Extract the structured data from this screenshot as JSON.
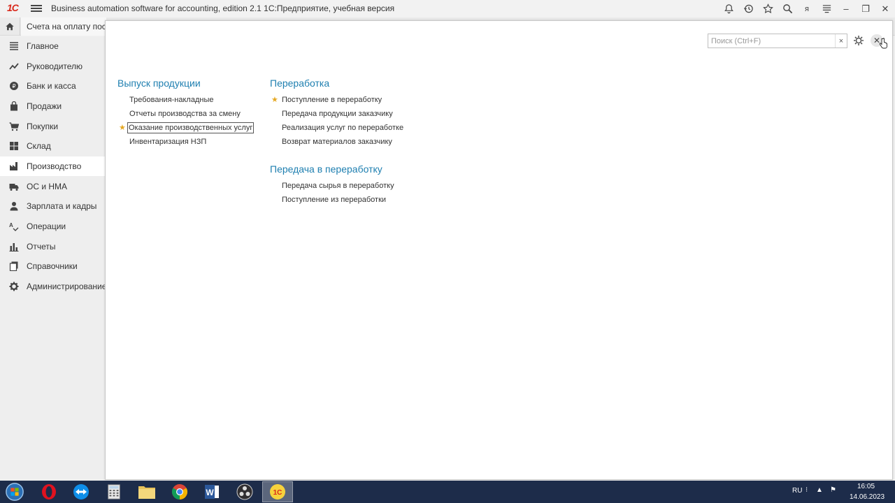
{
  "titlebar": {
    "logo": "1С",
    "title": "Business automation software for accounting, edition 2.1 1С:Предприятие, учебная версия",
    "icons": [
      "bell-icon",
      "history-icon",
      "star-icon",
      "search-icon",
      "user-icon",
      "menu-lines-icon"
    ],
    "user_initial": "я"
  },
  "tabs": {
    "open_tab": "Счета на оплату постав"
  },
  "sidebar": {
    "items": [
      {
        "label": "Главное",
        "icon": "list-icon"
      },
      {
        "label": "Руководителю",
        "icon": "trend-icon"
      },
      {
        "label": "Банк и касса",
        "icon": "coin-icon"
      },
      {
        "label": "Продажи",
        "icon": "bag-icon"
      },
      {
        "label": "Покупки",
        "icon": "cart-icon"
      },
      {
        "label": "Склад",
        "icon": "grid-icon"
      },
      {
        "label": "Производство",
        "icon": "factory-icon"
      },
      {
        "label": "ОС и НМА",
        "icon": "truck-icon"
      },
      {
        "label": "Зарплата и кадры",
        "icon": "person-icon"
      },
      {
        "label": "Операции",
        "icon": "operations-icon"
      },
      {
        "label": "Отчеты",
        "icon": "bar-chart-icon"
      },
      {
        "label": "Справочники",
        "icon": "books-icon"
      },
      {
        "label": "Администрирование",
        "icon": "gear-icon"
      }
    ],
    "active": "Производство"
  },
  "panel": {
    "search_placeholder": "Поиск (Ctrl+F)",
    "search_value": "",
    "clear_label": "×",
    "close_label": "✕",
    "sections": [
      {
        "title": "Выпуск продукции",
        "commands": [
          {
            "label": "Требования-накладные",
            "starred": false,
            "focused": false
          },
          {
            "label": "Отчеты производства за смену",
            "starred": false,
            "focused": false
          },
          {
            "label": "Оказание производственных услуг",
            "starred": true,
            "focused": true
          },
          {
            "label": "Инвентаризация НЗП",
            "starred": false,
            "focused": false
          }
        ]
      },
      {
        "title": "Переработка",
        "commands": [
          {
            "label": "Поступление в переработку",
            "starred": true,
            "focused": false
          },
          {
            "label": "Передача продукции заказчику",
            "starred": false,
            "focused": false
          },
          {
            "label": "Реализация услуг по переработке",
            "starred": false,
            "focused": false
          },
          {
            "label": "Возврат материалов заказчику",
            "starred": false,
            "focused": false
          }
        ]
      },
      {
        "title": "Передача в переработку",
        "commands": [
          {
            "label": "Передача сырья в переработку",
            "starred": false,
            "focused": false
          },
          {
            "label": "Поступление из переработки",
            "starred": false,
            "focused": false
          }
        ]
      }
    ]
  },
  "taskbar": {
    "apps": [
      "windows-start-icon",
      "opera-icon",
      "teamviewer-icon",
      "calculator-icon",
      "folder-icon",
      "chrome-icon",
      "word-icon",
      "obs-icon",
      "1c-icon"
    ],
    "lang": "RU",
    "time": "16:05",
    "date": "14.06.2023"
  },
  "colors": {
    "section_title": "#1e7fb0",
    "star": "#e5a823",
    "taskbar": "#1d2c4a",
    "logo": "#d9291c"
  }
}
